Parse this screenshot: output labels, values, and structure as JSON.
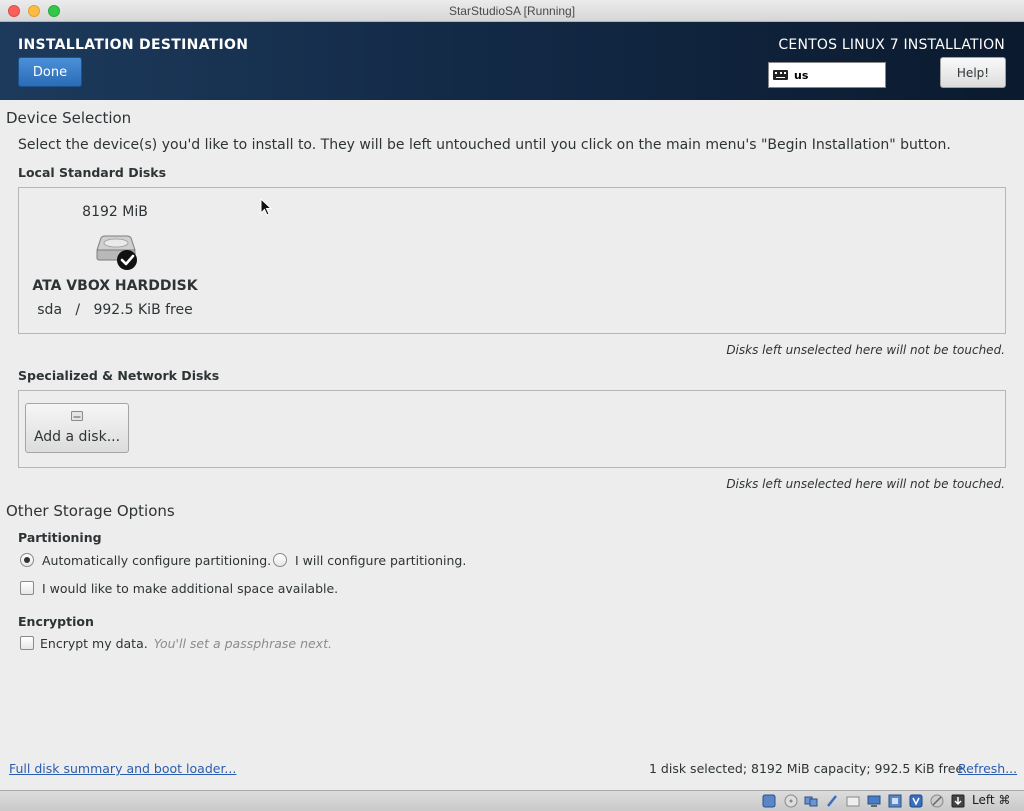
{
  "window": {
    "title": "StarStudioSA [Running]"
  },
  "header": {
    "title": "INSTALLATION DESTINATION",
    "done_label": "Done",
    "product": "CENTOS LINUX 7 INSTALLATION",
    "keyboard_layout": "us",
    "help_label": "Help!"
  },
  "device_selection": {
    "title": "Device Selection",
    "instructions": "Select the device(s) you'd like to install to.  They will be left untouched until you click on the main menu's \"Begin Installation\" button.",
    "local_disks": {
      "title": "Local Standard Disks",
      "disks": [
        {
          "size": "8192 MiB",
          "name": "ATA VBOX HARDDISK",
          "device": "sda",
          "separator": "/",
          "free": "992.5 KiB free",
          "selected": true
        }
      ],
      "note": "Disks left unselected here will not be touched."
    },
    "network_disks": {
      "title": "Specialized & Network Disks",
      "add_label": "Add a disk...",
      "note": "Disks left unselected here will not be touched."
    }
  },
  "other_storage": {
    "title": "Other Storage Options",
    "partitioning": {
      "title": "Partitioning",
      "auto_label": "Automatically configure partitioning.",
      "manual_label": "I will configure partitioning.",
      "selected": "auto",
      "extra_space_label": "I would like to make additional space available."
    },
    "encryption": {
      "title": "Encryption",
      "encrypt_label": "Encrypt my data.",
      "encrypt_hint": "You'll set a passphrase next."
    }
  },
  "footer": {
    "summary_link": "Full disk summary and boot loader...",
    "status": "1 disk selected; 8192 MiB capacity; 992.5 KiB free",
    "refresh_link": "Refresh..."
  },
  "vm_statusbar": {
    "host_key": "Left ⌘"
  }
}
